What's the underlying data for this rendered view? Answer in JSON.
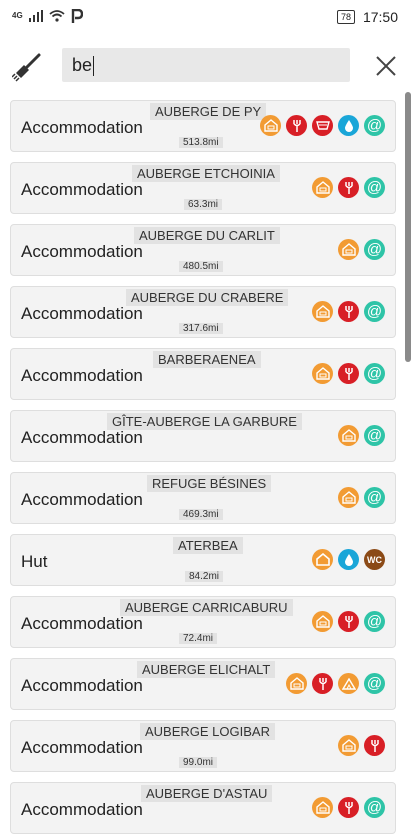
{
  "status_bar": {
    "network": "4G",
    "battery": "78",
    "time": "17:50"
  },
  "search": {
    "value": "be"
  },
  "results": [
    {
      "category": "Accommodation",
      "title": "AUBERGE DE PY",
      "distance": "513.8mi",
      "icons": [
        "lodge-icon",
        "restaurant-icon",
        "shop-icon",
        "water-icon",
        "email-icon"
      ]
    },
    {
      "category": "Accommodation",
      "title": "AUBERGE ETCHOINIA",
      "distance": "63.3mi",
      "icons": [
        "lodge-icon",
        "restaurant-icon",
        "email-icon"
      ]
    },
    {
      "category": "Accommodation",
      "title": "AUBERGE DU CARLIT",
      "distance": "480.5mi",
      "icons": [
        "lodge-icon",
        "email-icon"
      ]
    },
    {
      "category": "Accommodation",
      "title": "AUBERGE DU CRABERE",
      "distance": "317.6mi",
      "icons": [
        "lodge-icon",
        "restaurant-icon",
        "email-icon"
      ]
    },
    {
      "category": "Accommodation",
      "title": "BARBERAENEA",
      "distance": "",
      "icons": [
        "lodge-icon",
        "restaurant-icon",
        "email-icon"
      ]
    },
    {
      "category": "Accommodation",
      "title": "GÎTE-AUBERGE LA GARBURE",
      "distance": "",
      "icons": [
        "lodge-icon",
        "email-icon"
      ]
    },
    {
      "category": "Accommodation",
      "title": "REFUGE BÉSINES",
      "distance": "469.3mi",
      "icons": [
        "lodge-icon",
        "email-icon"
      ]
    },
    {
      "category": "Hut",
      "title": "ATERBEA",
      "distance": "84.2mi",
      "icons": [
        "hut-icon",
        "water-icon",
        "wc-icon"
      ]
    },
    {
      "category": "Accommodation",
      "title": "AUBERGE CARRICABURU",
      "distance": "72.4mi",
      "icons": [
        "lodge-icon",
        "restaurant-icon",
        "email-icon"
      ]
    },
    {
      "category": "Accommodation",
      "title": "AUBERGE ELICHALT",
      "distance": "",
      "icons": [
        "lodge-icon",
        "restaurant-icon",
        "camping-icon",
        "email-icon"
      ]
    },
    {
      "category": "Accommodation",
      "title": "AUBERGE LOGIBAR",
      "distance": "99.0mi",
      "icons": [
        "lodge-icon",
        "restaurant-icon"
      ]
    },
    {
      "category": "Accommodation",
      "title": "AUBERGE D'ASTAU",
      "distance": "",
      "icons": [
        "lodge-icon",
        "restaurant-icon",
        "email-icon"
      ]
    }
  ],
  "wc_label": "WC",
  "colors": {
    "lodge": "#f29b33",
    "restaurant": "#d81f26",
    "email": "#2ec4a7",
    "water": "#1aa6d8",
    "wc": "#8b4a16"
  }
}
